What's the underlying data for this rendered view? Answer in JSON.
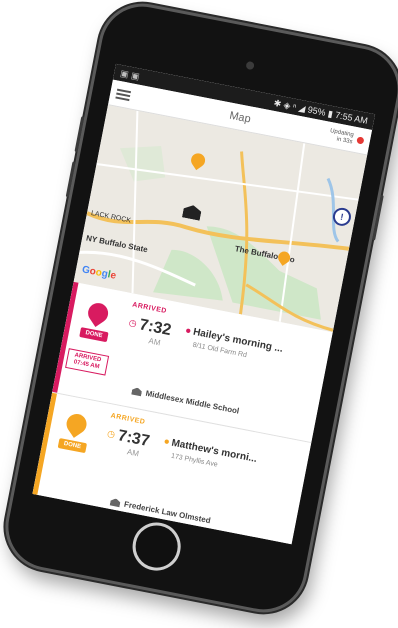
{
  "status_bar": {
    "left": "▣ ▣",
    "right": "✱ ◈ ⁿ ◢ 95% ▮ 7:55 AM"
  },
  "header": {
    "title": "Map",
    "update_line1": "Updating",
    "update_line2": "in 33s"
  },
  "map": {
    "labels": {
      "zoo": "The Buffalo Zoo",
      "buffalo_state": "NY Buffalo State",
      "black_rock": "LACK ROCK"
    },
    "google": [
      "G",
      "o",
      "o",
      "g",
      "l",
      "e"
    ]
  },
  "stops": [
    {
      "badge": "DONE",
      "arrived_label": "ARRIVED",
      "time": "7:32",
      "ampm": "AM",
      "name": "Hailey's morning ...",
      "address": "8/11 Old Farm Rd",
      "arrived_time_line1": "ARRIVED",
      "arrived_time_line2": "07:45 AM",
      "school": "Middlesex Middle School",
      "color": "#d81b60"
    },
    {
      "badge": "DONE",
      "arrived_label": "ARRIVED",
      "time": "7:37",
      "ampm": "AM",
      "name": "Matthew's morni...",
      "address": "173 Phyllis Ave",
      "school": "Frederick Law Olmsted",
      "color": "#f5a623"
    }
  ],
  "colors": {
    "pink": "#d81b60",
    "orange": "#f5a623",
    "phone_body": "#121212"
  }
}
